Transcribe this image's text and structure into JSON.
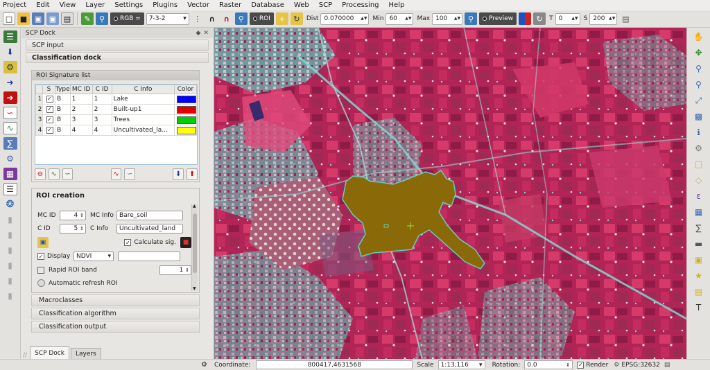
{
  "menu": [
    "Project",
    "Edit",
    "View",
    "Layer",
    "Settings",
    "Plugins",
    "Vector",
    "Raster",
    "Database",
    "Web",
    "SCP",
    "Processing",
    "Help"
  ],
  "toolbar": {
    "rgb_label": "RGB =",
    "rgb_value": "7-3-2",
    "roi_label": "ROI",
    "dist_label": "Dist",
    "dist_value": "0.070000",
    "min_label": "Min",
    "min_value": "60",
    "max_label": "Max",
    "max_value": "100",
    "preview_label": "Preview",
    "t_label": "T",
    "t_value": "0",
    "s_label": "S",
    "s_value": "200"
  },
  "dock": {
    "title": "SCP Dock",
    "scp_input": "SCP input",
    "classification_dock": "Classification dock",
    "roi_signature_list": "ROI Signature list",
    "table_headers": [
      "S",
      "Type",
      "MC ID",
      "C ID",
      "C Info",
      "Color"
    ],
    "rows": [
      {
        "num": "1",
        "type": "B",
        "mcid": "1",
        "cid": "1",
        "cinfo": "Lake",
        "color": "#0000ff"
      },
      {
        "num": "2",
        "type": "B",
        "mcid": "2",
        "cid": "2",
        "cinfo": "Built-up1",
        "color": "#e00000"
      },
      {
        "num": "3",
        "type": "B",
        "mcid": "3",
        "cid": "3",
        "cinfo": "Trees",
        "color": "#00d000"
      },
      {
        "num": "4",
        "type": "B",
        "mcid": "4",
        "cid": "4",
        "cinfo": "Uncultivated_la...",
        "color": "#ffff00"
      }
    ],
    "roi_creation": "ROI creation",
    "mc_id_label": "MC ID",
    "mc_id_value": "4",
    "mc_info_label": "MC Info",
    "mc_info_value": "Bare_soil",
    "c_id_label": "C ID",
    "c_id_value": "5",
    "c_info_label": "C Info",
    "c_info_value": "Uncultivated_land",
    "calculate_sig": "Calculate sig.",
    "display_label": "Display",
    "display_value": "NDVI",
    "rapid_roi_band": "Rapid ROI band",
    "rapid_roi_value": "1",
    "auto_refresh": "Automatic refresh ROI",
    "macroclasses": "Macroclasses",
    "classification_algorithm": "Classification algorithm",
    "classification_output": "Classification output",
    "tab_scp": "SCP Dock",
    "tab_layers": "Layers"
  },
  "status": {
    "coordinate_label": "Coordinate:",
    "coordinate_value": "800417,4631568",
    "scale_label": "Scale",
    "scale_value": "1:13,116",
    "rotation_label": "Rotation:",
    "rotation_value": "0.0",
    "render_label": "Render",
    "epsg": "EPSG:32632"
  },
  "colors": {
    "roi_polygon_fill": "#8a6a08",
    "roi_polygon_stroke": "#5fd0c0",
    "map_base": "#b02456"
  }
}
